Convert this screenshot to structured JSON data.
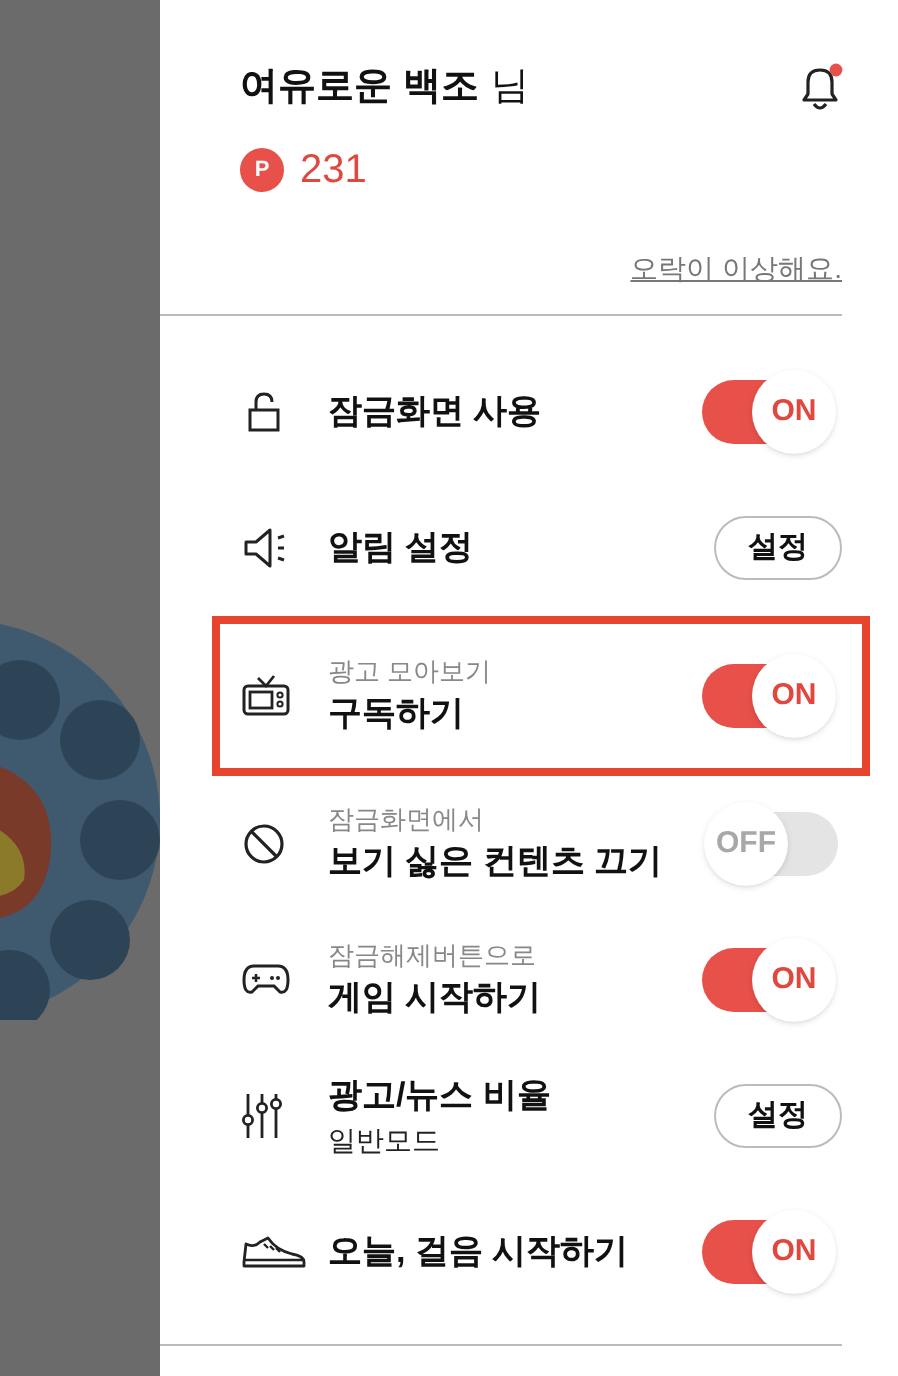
{
  "drawer": {
    "user_name": "여유로운 백조",
    "honorific": "님",
    "notification_badge": true,
    "points": {
      "icon": "P",
      "value": "231"
    },
    "report_link": "오락이 이상해요.",
    "items": [
      {
        "kind": "toggle",
        "title": "잠금화면 사용",
        "on": true,
        "toggle_label": "ON",
        "highlighted": false
      },
      {
        "kind": "button",
        "title": "알림 설정",
        "button": "설정",
        "highlighted": false
      },
      {
        "kind": "toggle",
        "caption": "광고 모아보기",
        "title": "구독하기",
        "on": true,
        "toggle_label": "ON",
        "highlighted": true
      },
      {
        "kind": "toggle",
        "caption": "잠금화면에서",
        "title": "보기 싫은 컨텐츠 끄기",
        "on": false,
        "toggle_label": "OFF",
        "highlighted": false
      },
      {
        "kind": "toggle",
        "caption": "잠금해제버튼으로",
        "title": "게임 시작하기",
        "on": true,
        "toggle_label": "ON",
        "highlighted": false
      },
      {
        "kind": "button",
        "title": "광고/뉴스 비율",
        "note": "일반모드",
        "button": "설정",
        "highlighted": false
      },
      {
        "kind": "toggle",
        "title": "오늘, 걸음 시작하기",
        "on": true,
        "toggle_label": "ON",
        "highlighted": false
      }
    ]
  }
}
